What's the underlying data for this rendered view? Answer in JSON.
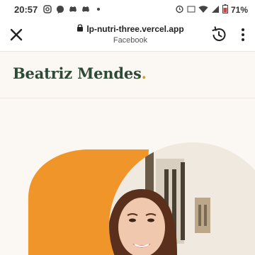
{
  "status_bar": {
    "time": "20:57",
    "battery_percent": "71%",
    "icons": [
      "instagram-icon",
      "messenger-icon",
      "discord-icon",
      "discord-icon",
      "notification-dot-icon",
      "alarm-icon",
      "volte-icon",
      "wifi-icon",
      "signal-icon",
      "battery-icon"
    ]
  },
  "browser": {
    "url": "lp-nutri-three.vercel.app",
    "subtitle": "Facebook",
    "icons": [
      "close-icon",
      "lock-icon",
      "history-icon",
      "more-vert-icon"
    ]
  },
  "site": {
    "brand_name": "Beatriz Mendes",
    "brand_dot": ".",
    "brand_color": "#2e4a35",
    "accent_color": "#c79a43",
    "hero_shape_color": "#f0952a"
  }
}
